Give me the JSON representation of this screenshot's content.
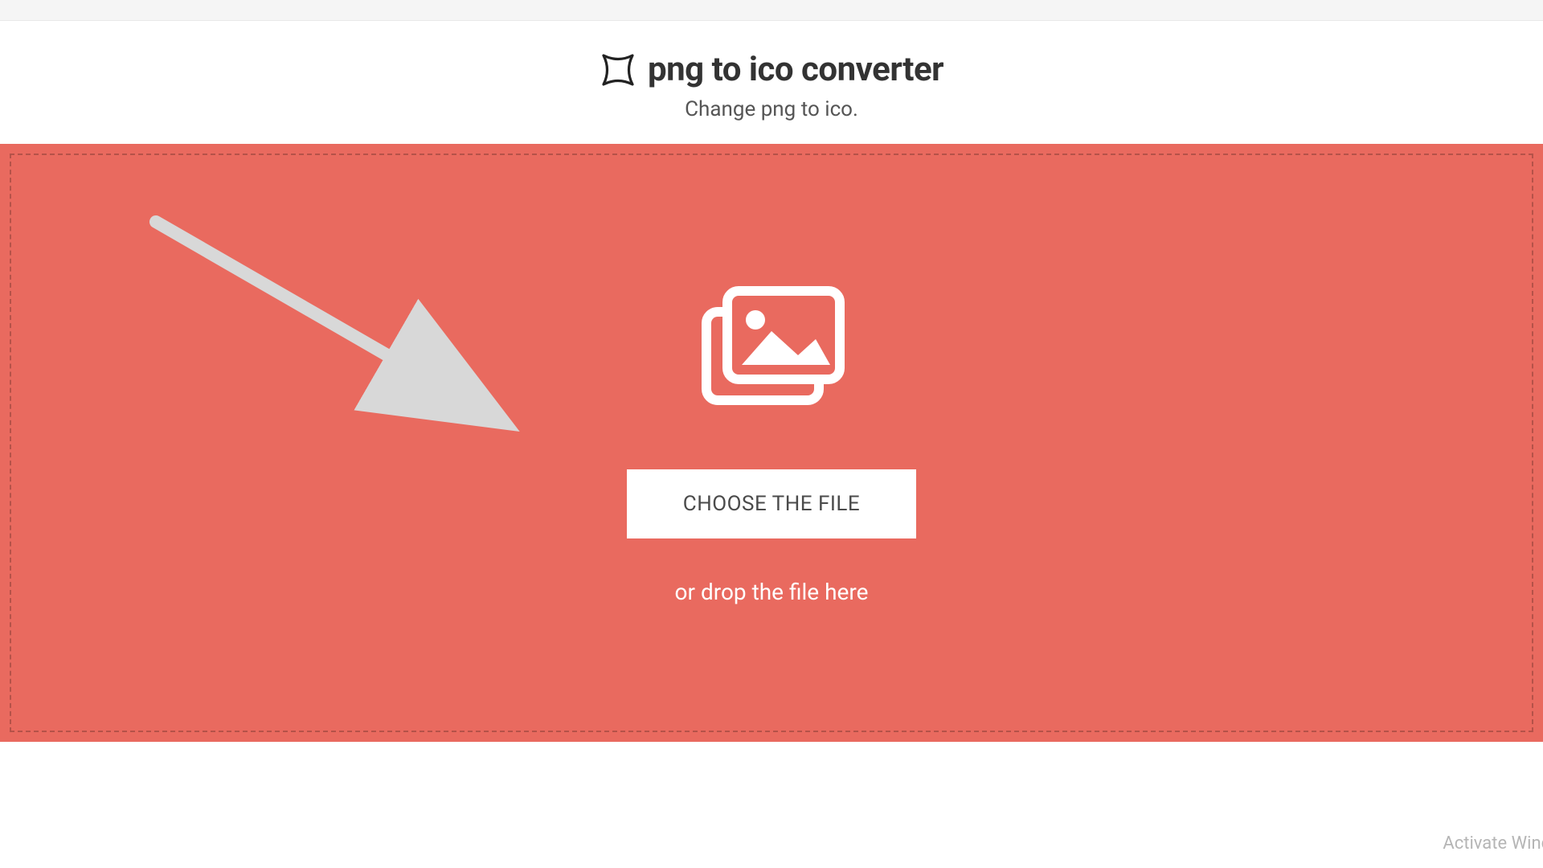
{
  "header": {
    "title": "png to ico converter",
    "subtitle": "Change png to ico."
  },
  "dropzone": {
    "choose_button_label": "CHOOSE THE FILE",
    "drop_hint": "or drop the file here"
  },
  "watermark": {
    "text": "Activate Wind"
  },
  "colors": {
    "accent": "#e96a5f",
    "text_dark": "#333333",
    "text_muted": "#555555",
    "button_bg": "#ffffff"
  }
}
